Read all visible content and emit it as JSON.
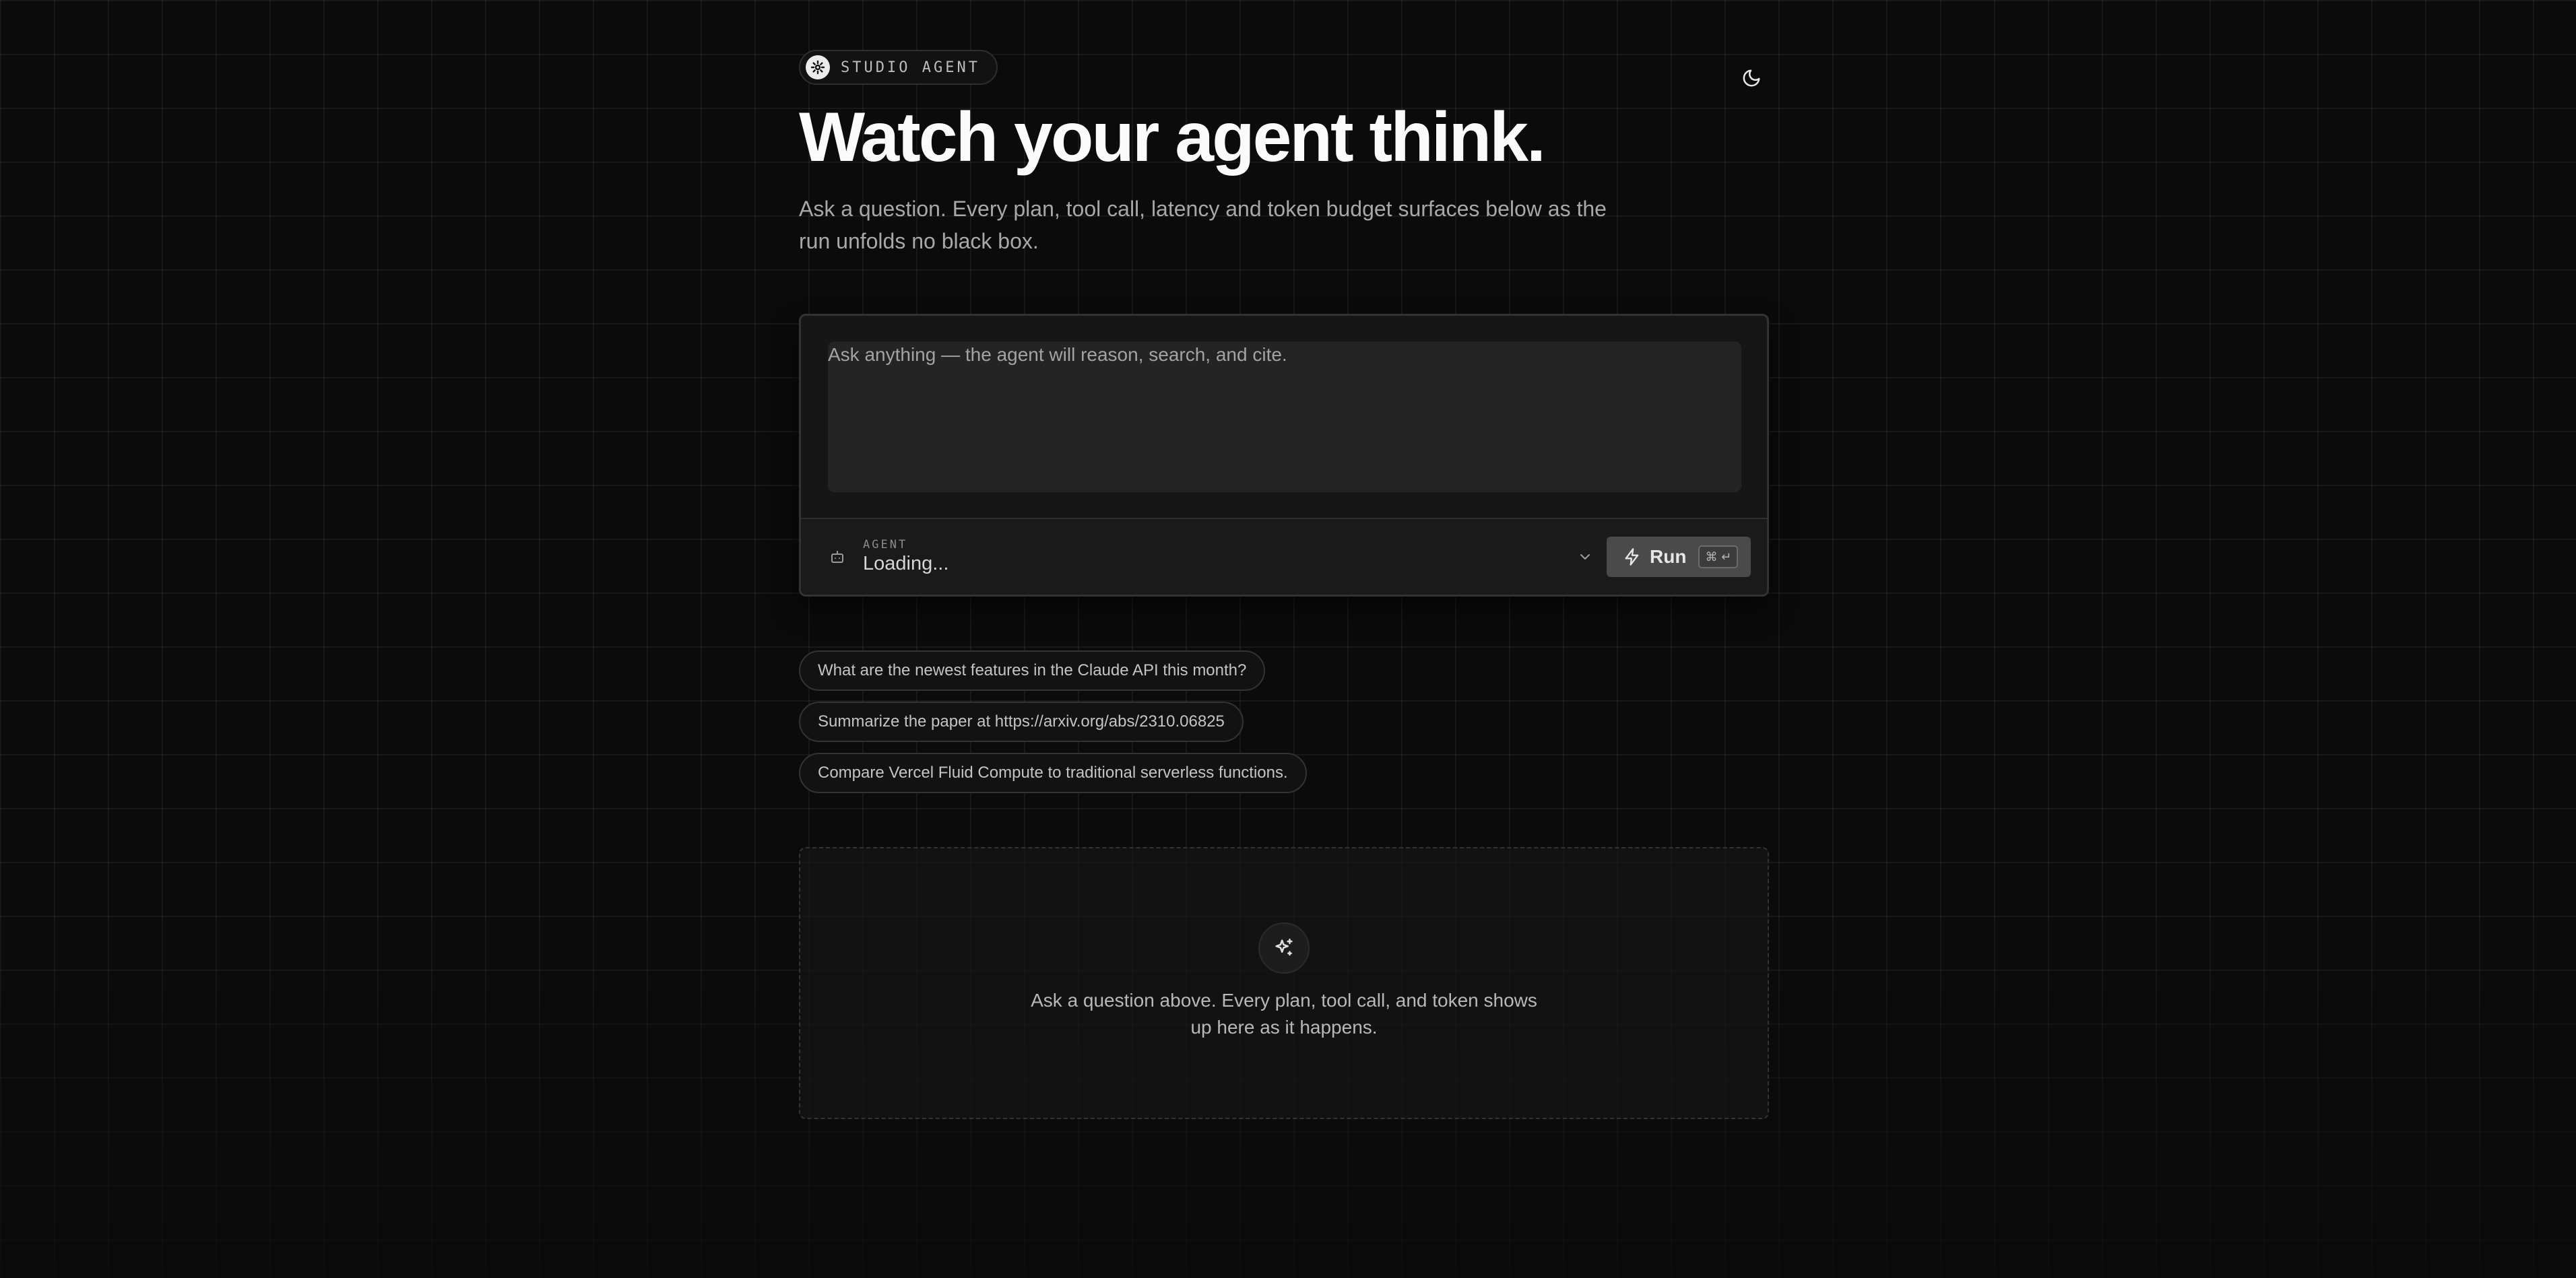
{
  "header": {
    "badge_label": "STUDIO AGENT",
    "title": "Watch your agent think.",
    "subtitle": "Ask a question. Every plan, tool call, latency and token budget surfaces below as the run unfolds no black box.",
    "theme_toggle_icon": "moon-icon"
  },
  "composer": {
    "placeholder": "Ask anything — the agent will reason, search, and cite.",
    "value": "",
    "agent_caption": "AGENT",
    "agent_value": "Loading...",
    "run_label": "Run",
    "shortcut": "⌘ ↵"
  },
  "suggestions": [
    "What are the newest features in the Claude API this month?",
    "Summarize the paper at https://arxiv.org/abs/2310.06825",
    "Compare Vercel Fluid Compute to traditional serverless functions."
  ],
  "empty_state": {
    "icon": "sparkles-icon",
    "message": "Ask a question above. Every plan, tool call, and token shows up here as it happens."
  },
  "colors": {
    "background": "#0b0b0b",
    "panel": "#161616",
    "input": "#242424",
    "run_button": "#4a4a4a",
    "text_primary": "#fafafa",
    "text_muted": "#a8a8a8"
  }
}
